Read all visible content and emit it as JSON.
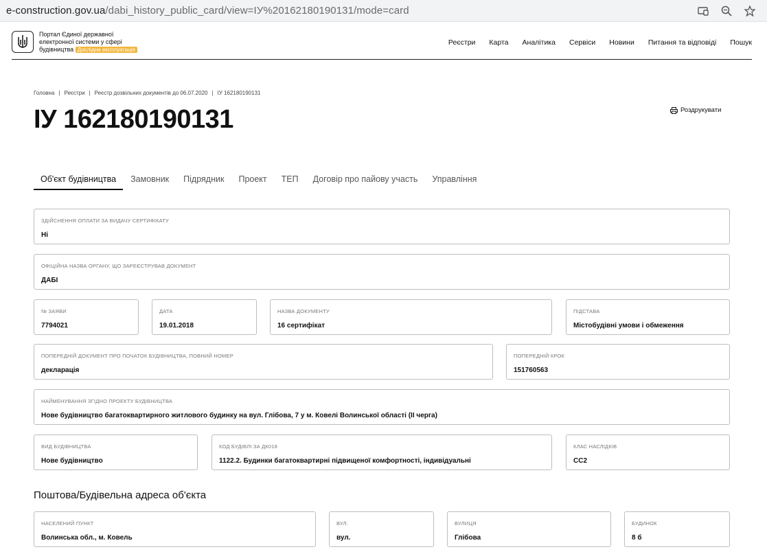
{
  "browser": {
    "url_host": "e-construction.gov.ua",
    "url_path": "/dabi_history_public_card/view=IУ%20162180190131/mode=card",
    "icons": [
      "cast-icon",
      "zoom-icon",
      "bookmark-star-icon"
    ]
  },
  "header": {
    "brand_line1": "Портал Єдиної державної",
    "brand_line2": "електронної системи у сфері",
    "brand_line3": "будівництва",
    "badge": "Дослідна експлуатація",
    "nav": [
      "Реєстри",
      "Карта",
      "Аналітика",
      "Сервіси",
      "Новини",
      "Питання та відповіді",
      "Пошук"
    ]
  },
  "breadcrumbs": [
    "Головна",
    "Реєстри",
    "Реєстр дозвільних документів до 06.07.2020",
    "ІУ 162180190131"
  ],
  "page": {
    "title": "ІУ 162180190131",
    "print_label": "Роздрукувати"
  },
  "tabs": [
    "Об'єкт будівництва",
    "Замовник",
    "Підрядник",
    "Проект",
    "ТЕП",
    "Договір про пайову участь",
    "Управління"
  ],
  "fields": {
    "payment": {
      "label": "Здійснення оплати за видачу сертифікату",
      "value": "Ні"
    },
    "authority": {
      "label": "Офіційна назва органу, що зареєстрував документ",
      "value": "ДАБІ"
    },
    "app_no": {
      "label": "№ заяви",
      "value": "7794021"
    },
    "date": {
      "label": "Дата",
      "value": "19.01.2018"
    },
    "doc_name": {
      "label": "Назва документу",
      "value": "16 сертифікат"
    },
    "basis": {
      "label": "Підстава",
      "value": "Містобудівні умови і обмеження"
    },
    "prev_doc": {
      "label": "Попередній документ про початок будівництва, повний номер",
      "value": "декларація"
    },
    "prev_step": {
      "label": "Попередній крок",
      "value": "151760563"
    },
    "project_name": {
      "label": "Найменування згідно проекту будівництва",
      "value": "Нове будівництво багатоквартирного житлового будинку на вул. Глібова, 7 у м. Ковелі Волинської області (ІІ черга)"
    },
    "build_type": {
      "label": "Вид будівництва",
      "value": "Нове будівництво"
    },
    "dk_code": {
      "label": "Код будівлі за ДК018",
      "value": "1122.2. Будинки багатоквартирні підвищеної комфортності, індивідуальні"
    },
    "cc_class": {
      "label": "Клас наслідків",
      "value": "СС2"
    },
    "locality": {
      "label": "Населений пункт",
      "value": "Волинська обл., м. Ковель"
    },
    "street_type": {
      "label": "Вул.",
      "value": "вул."
    },
    "street": {
      "label": "Вулиця",
      "value": "Глібова"
    },
    "building": {
      "label": "Будинок",
      "value": "8 б"
    }
  },
  "address_section_title": "Поштова/Будівельна адреса об'єкта"
}
